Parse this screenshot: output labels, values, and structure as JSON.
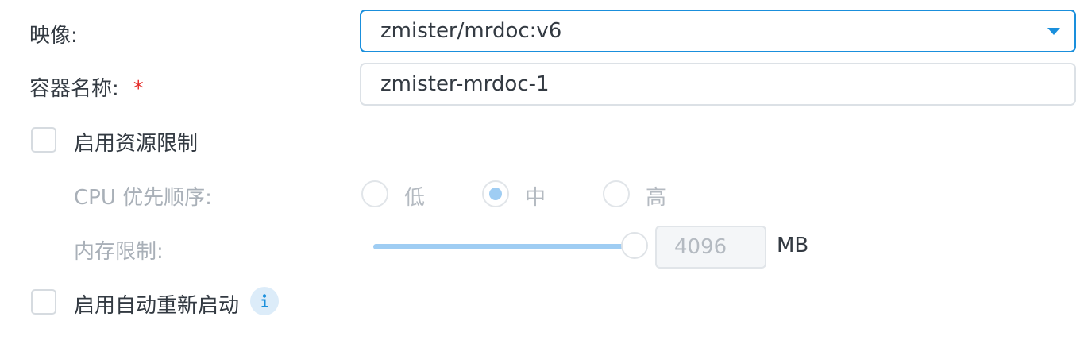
{
  "image_field": {
    "label": "映像:",
    "value": "zmister/mrdoc:v6"
  },
  "container_name_field": {
    "label": "容器名称:",
    "required_mark": "*",
    "value": "zmister-mrdoc-1"
  },
  "resource_limit": {
    "checkbox_label": "启用资源限制",
    "checked": false,
    "cpu_priority": {
      "label": "CPU 优先顺序:",
      "options": [
        "低",
        "中",
        "高"
      ],
      "selected": "中"
    },
    "memory_limit": {
      "label": "内存限制:",
      "value": "4096",
      "unit": "MB",
      "slider_fraction": 1.0
    }
  },
  "auto_restart": {
    "checkbox_label": "启用自动重新启动",
    "checked": false,
    "icon": "info-icon"
  },
  "colors": {
    "accent": "#1a8fdc",
    "required": "#e5302d",
    "disabled_text": "#b4bac1",
    "slider_fill": "#9fcdf3"
  }
}
